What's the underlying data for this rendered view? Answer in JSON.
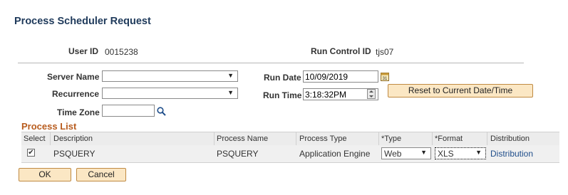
{
  "page_title": "Process Scheduler Request",
  "user_id": {
    "label": "User ID",
    "value": "0015238"
  },
  "run_control_id": {
    "label": "Run Control ID",
    "value": "tjs07"
  },
  "server_name": {
    "label": "Server Name",
    "value": ""
  },
  "recurrence": {
    "label": "Recurrence",
    "value": ""
  },
  "time_zone": {
    "label": "Time Zone",
    "value": ""
  },
  "run_date": {
    "label": "Run Date",
    "value": "10/09/2019"
  },
  "run_time": {
    "label": "Run Time",
    "value": "3:18:32PM"
  },
  "reset_button": "Reset to Current Date/Time",
  "process_list": {
    "title": "Process List",
    "headers": {
      "select": "Select",
      "description": "Description",
      "process_name": "Process Name",
      "process_type": "Process Type",
      "type": "*Type",
      "format": "*Format",
      "distribution": "Distribution"
    },
    "rows": [
      {
        "selected": true,
        "description": "PSQUERY",
        "process_name": "PSQUERY",
        "process_type": "Application Engine",
        "type": "Web",
        "format": "XLS",
        "distribution": "Distribution"
      }
    ]
  },
  "ok_button": "OK",
  "cancel_button": "Cancel",
  "icons": {
    "calendar": "calendar-icon",
    "search": "search-icon",
    "clock": "time-spinner-icon",
    "dropdown": "chevron-down-icon"
  },
  "colors": {
    "title": "#1f3a5b",
    "section_title": "#b85c1e",
    "button_bg": "#fbe7c4",
    "link": "#1e4d8a"
  }
}
